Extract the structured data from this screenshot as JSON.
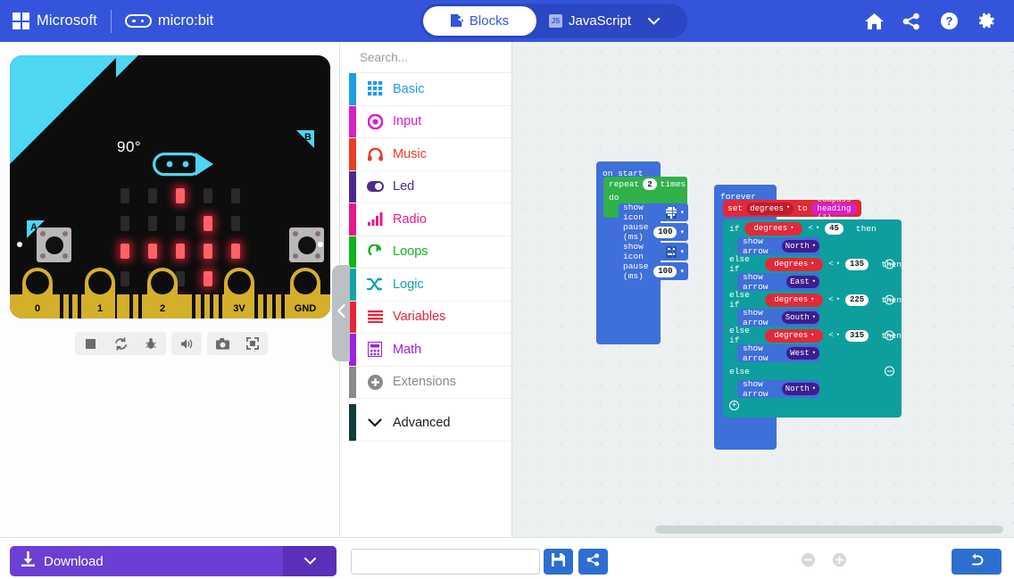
{
  "header": {
    "brand": "Microsoft",
    "product": "micro:bit",
    "ms_logo_icon": "microsoft-squares-icon",
    "mb_logo_icon": "microbit-face-icon",
    "toggle": {
      "blocks_label": "Blocks",
      "blocks_icon": "puzzle-piece-icon",
      "javascript_label": "JavaScript",
      "javascript_icon": "js-badge-icon",
      "chevron_icon": "chevron-down-icon",
      "active": "Blocks"
    },
    "icons": [
      {
        "name": "home-icon",
        "title": "Home"
      },
      {
        "name": "share-icon",
        "title": "Share"
      },
      {
        "name": "help-icon",
        "title": "Help"
      },
      {
        "name": "gear-icon",
        "title": "Settings"
      }
    ],
    "bg_color": "#3455db"
  },
  "simulator": {
    "heading_label": "90°",
    "needle_icon": "compass-needle-icon",
    "button_a_label": "A",
    "button_b_label": "B",
    "pin_labels": [
      "0",
      "1",
      "2",
      "3V",
      "GND"
    ],
    "led_matrix": [
      [
        0,
        0,
        1,
        0,
        0
      ],
      [
        0,
        0,
        0,
        1,
        0
      ],
      [
        1,
        1,
        1,
        1,
        1
      ],
      [
        0,
        0,
        0,
        1,
        0
      ],
      [
        0,
        0,
        1,
        0,
        0
      ]
    ],
    "led_on_color": "#ff6167",
    "led_off_color": "#2a2a2a",
    "board_color": "#0d0d0d",
    "accent_color": "#4ed6f2",
    "pin_color": "#d4af2a",
    "controls": [
      {
        "name": "stop-button",
        "icon": "stop-icon"
      },
      {
        "name": "restart-button",
        "icon": "refresh-icon"
      },
      {
        "name": "debug-button",
        "icon": "bug-icon"
      },
      {
        "name": "mute-button",
        "icon": "speaker-icon"
      },
      {
        "name": "screenshot-button",
        "icon": "camera-icon"
      },
      {
        "name": "fullscreen-button",
        "icon": "expand-icon"
      }
    ]
  },
  "toolbox": {
    "search_placeholder": "Search...",
    "search_value": "",
    "search_icon": "search-icon",
    "collapse_icon": "chevron-left-icon",
    "items": [
      {
        "label": "Basic",
        "color": "#1e9ce8",
        "icon": "grid-icon"
      },
      {
        "label": "Input",
        "color": "#d820c6",
        "icon": "target-icon"
      },
      {
        "label": "Music",
        "color": "#eb3c25",
        "icon": "headphones-icon"
      },
      {
        "label": "Led",
        "color": "#4a2b8c",
        "icon": "toggle-icon"
      },
      {
        "label": "Radio",
        "color": "#e8188c",
        "icon": "bars-icon"
      },
      {
        "label": "Loops",
        "color": "#11b418",
        "icon": "loop-arrow-icon"
      },
      {
        "label": "Logic",
        "color": "#12a5a5",
        "icon": "shuffle-icon"
      },
      {
        "label": "Variables",
        "color": "#e8243c",
        "icon": "lines-icon"
      },
      {
        "label": "Math",
        "color": "#9c20e0",
        "icon": "calculator-icon"
      },
      {
        "label": "Extensions",
        "color": "#8a8a8a",
        "icon": "plus-circle-icon"
      }
    ],
    "advanced": {
      "label": "Advanced",
      "icon": "chevron-down-icon",
      "color": "#0f3c3c"
    }
  },
  "workspace": {
    "scrollbar_name": "horizontal-scrollbar",
    "on_start": {
      "hat_label": "on start",
      "repeat": {
        "label_prefix": "repeat",
        "count": "2",
        "label_suffix": "times",
        "do_label": "do",
        "statements": [
          {
            "type": "show-icon",
            "label": "show icon",
            "icon_name": "diamond-icon",
            "caret": "▾"
          },
          {
            "type": "pause",
            "label": "pause (ms)",
            "value": "100",
            "caret": "▾"
          },
          {
            "type": "show-icon",
            "label": "show icon",
            "icon_name": "small-diamond-icon",
            "caret": "▾"
          },
          {
            "type": "pause",
            "label": "pause (ms)",
            "value": "100",
            "caret": "▾"
          }
        ]
      }
    },
    "forever": {
      "hat_label": "forever",
      "set_block": {
        "set_label": "set",
        "variable": "degrees",
        "to_label": "to",
        "reporter": "compass heading (°)"
      },
      "conditions": [
        {
          "keyword": "if",
          "variable": "degrees",
          "operator": "<",
          "value": "45",
          "then_label": "then",
          "arrow": "North",
          "has_minus": false
        },
        {
          "keyword": "else if",
          "variable": "degrees",
          "operator": "<",
          "value": "135",
          "then_label": "then",
          "arrow": "East",
          "has_minus": true
        },
        {
          "keyword": "else if",
          "variable": "degrees",
          "operator": "<",
          "value": "225",
          "then_label": "then",
          "arrow": "South",
          "has_minus": true
        },
        {
          "keyword": "else if",
          "variable": "degrees",
          "operator": "<",
          "value": "315",
          "then_label": "then",
          "arrow": "West",
          "has_minus": true
        },
        {
          "keyword": "else",
          "variable": "",
          "operator": "",
          "value": "",
          "then_label": "",
          "arrow": "North",
          "has_minus": true
        }
      ],
      "show_arrow_label": "show arrow",
      "add_button_icon": "plus-circle-icon"
    }
  },
  "bottom_bar": {
    "download_label": "Download",
    "download_icon": "download-icon",
    "download_menu_icon": "chevron-down-icon",
    "download_color": "#6c3fd4",
    "project_name_value": "",
    "project_name_placeholder": "",
    "save_icon": "save-icon",
    "share_icon": "share-icon",
    "zoom_out_icon": "minus-circle-icon",
    "zoom_in_icon": "plus-circle-icon",
    "undo_icon": "undo-icon"
  }
}
